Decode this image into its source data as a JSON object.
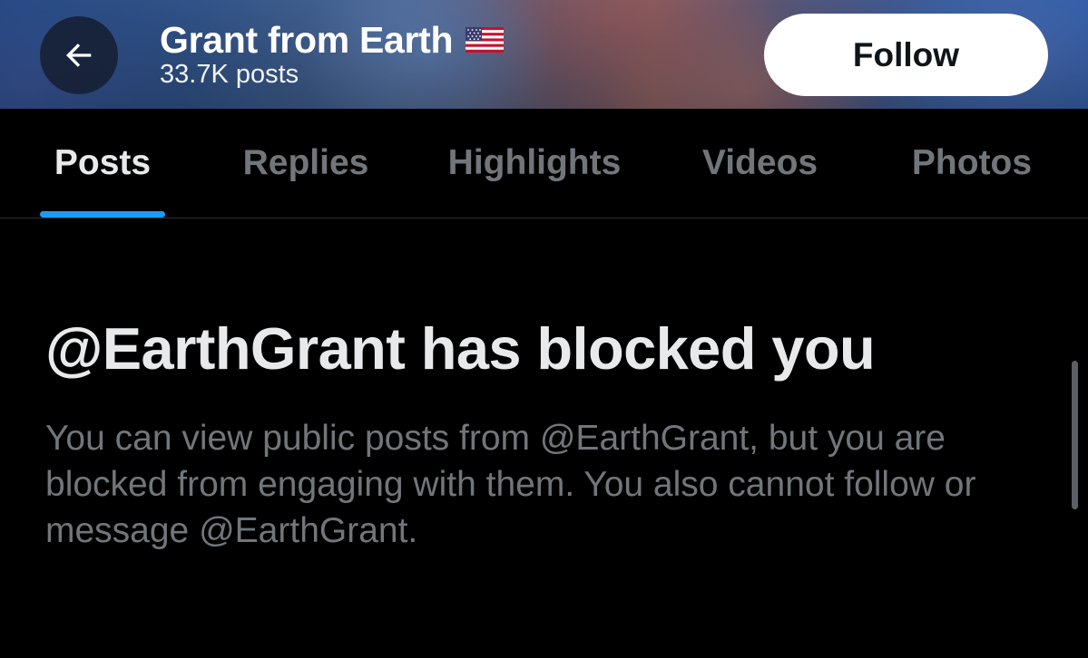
{
  "header": {
    "back_icon": "arrow-left-icon",
    "name": "Grant from Earth",
    "flag_icon": "us-flag-icon",
    "posts_count": "33.7K posts",
    "follow_label": "Follow"
  },
  "tabs": [
    {
      "label": "Posts",
      "active": true
    },
    {
      "label": "Replies",
      "active": false
    },
    {
      "label": "Highlights",
      "active": false
    },
    {
      "label": "Videos",
      "active": false
    },
    {
      "label": "Photos",
      "active": false
    }
  ],
  "notice": {
    "title": "@EarthGrant has blocked you",
    "description": "You can view public posts from @EarthGrant, but you are blocked from engaging with them. You also cannot follow or message @EarthGrant."
  },
  "colors": {
    "background": "#000000",
    "accent": "#1d9bf0",
    "primary_text": "#e7e9ea",
    "secondary_text": "#71767b"
  }
}
